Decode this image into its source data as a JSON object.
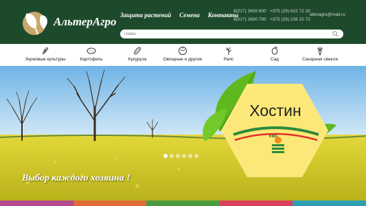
{
  "brand": {
    "name": "АльтерАгро"
  },
  "topnav": [
    "Защита растений",
    "Семена",
    "Контакты"
  ],
  "contacts": {
    "phone1": "8(017) 2600 600",
    "phone2": "8(017) 2600 700",
    "mobile1": "+375 (29) 622 72 33",
    "mobile2": "+375 (29) 228 22 72",
    "email": "alteragro@mail.ru"
  },
  "search": {
    "placeholder": "Поиск"
  },
  "categories": [
    {
      "label": "Зерновые культуры",
      "icon": "wheat-icon"
    },
    {
      "label": "Картофель",
      "icon": "potato-icon"
    },
    {
      "label": "Кукуруза",
      "icon": "corn-icon"
    },
    {
      "label": "Овощные и другие",
      "icon": "vegetables-icon"
    },
    {
      "label": "Рапс",
      "icon": "rapeseed-icon"
    },
    {
      "label": "Сад",
      "icon": "garden-icon"
    },
    {
      "label": "Сахарная свекла",
      "icon": "sugar-beet-icon"
    }
  ],
  "hero": {
    "product": "Хостин",
    "slogan": "Выбор каждого хозяина !",
    "badge": "KWS",
    "slide_count": 6,
    "active_slide": 1
  },
  "colors": {
    "header": "#1e4a2c",
    "accent": "#76b82a",
    "strips": [
      "#b44a8c",
      "#e26b3a",
      "#4a9b3f",
      "#d9405a",
      "#2e9fae"
    ]
  }
}
